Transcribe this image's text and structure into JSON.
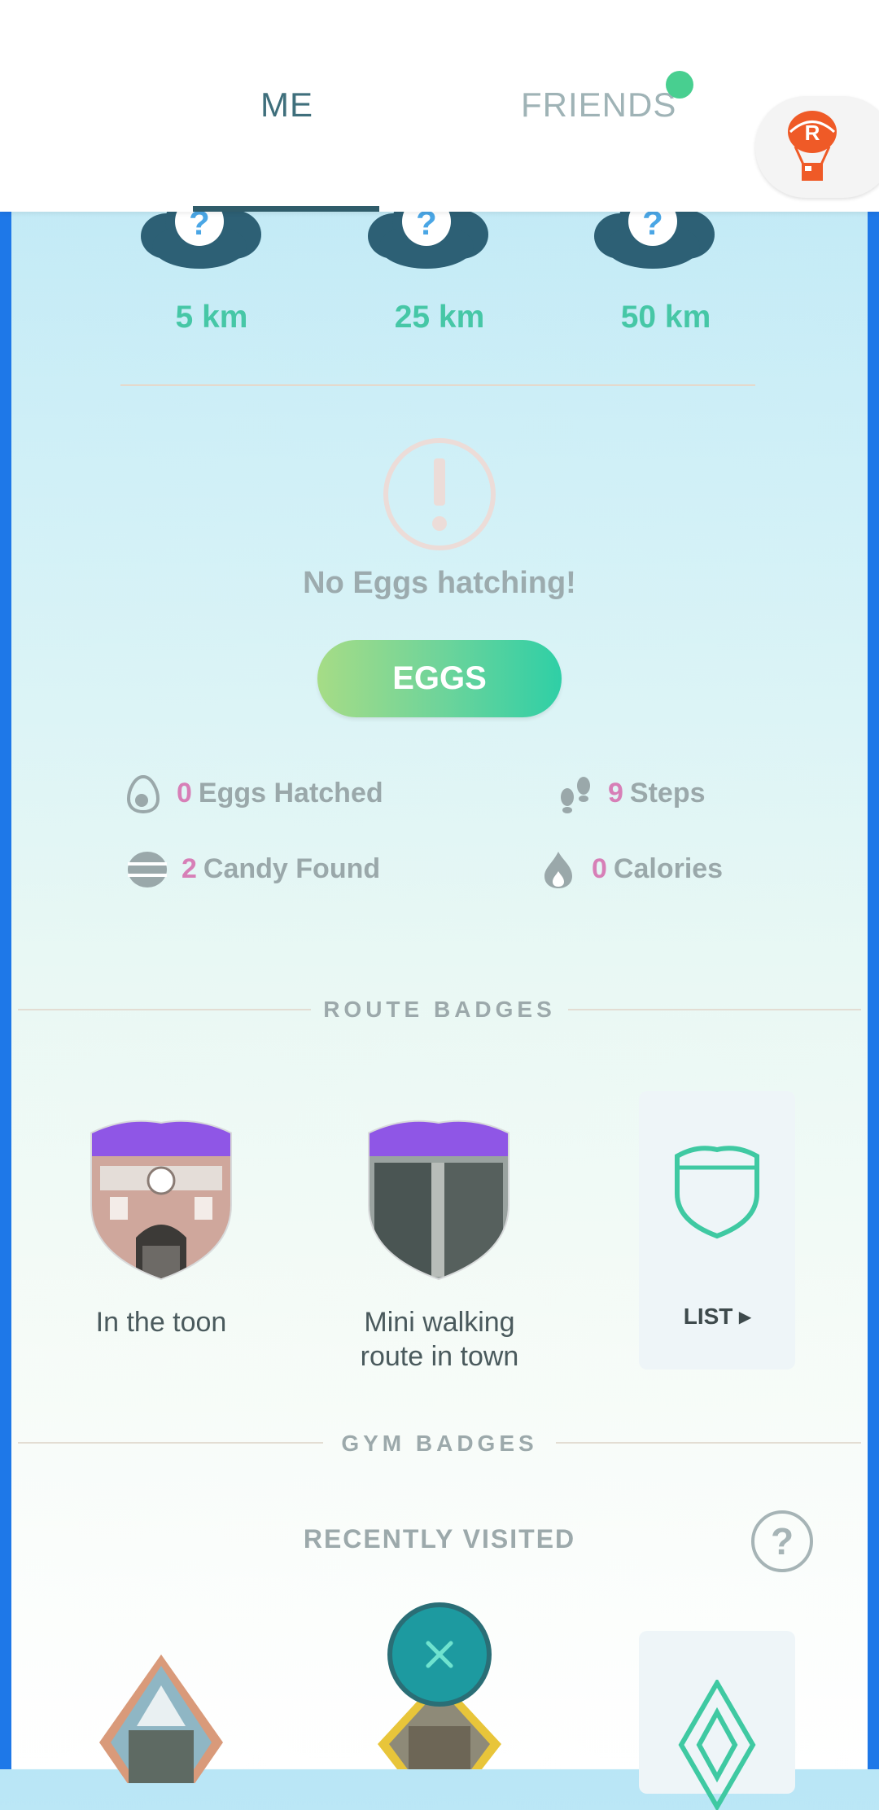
{
  "tabs": {
    "me": "ME",
    "friends": "FRIENDS"
  },
  "egg_distances": [
    "5 km",
    "25 km",
    "50 km"
  ],
  "egg_status": "No Eggs hatching!",
  "eggs_button": "EGGS",
  "stats": {
    "eggs_hatched": {
      "value": "0",
      "label": "Eggs Hatched"
    },
    "steps": {
      "value": "9",
      "label": "Steps"
    },
    "candy_found": {
      "value": "2",
      "label": "Candy Found"
    },
    "calories": {
      "value": "0",
      "label": "Calories"
    }
  },
  "route_badges": {
    "title": "ROUTE BADGES",
    "items": [
      {
        "label": "In the toon"
      },
      {
        "label_line1": "Mini walking",
        "label_line2": "route in town"
      }
    ],
    "list_label": "LIST ▸"
  },
  "gym_badges": {
    "title": "GYM BADGES",
    "recently_visited": "RECENTLY VISITED",
    "help": "?"
  },
  "colors": {
    "accent": "#46c7a6",
    "number": "#d77fb7",
    "frame": "#1e78e8",
    "route_purple": "#8f56e6"
  }
}
